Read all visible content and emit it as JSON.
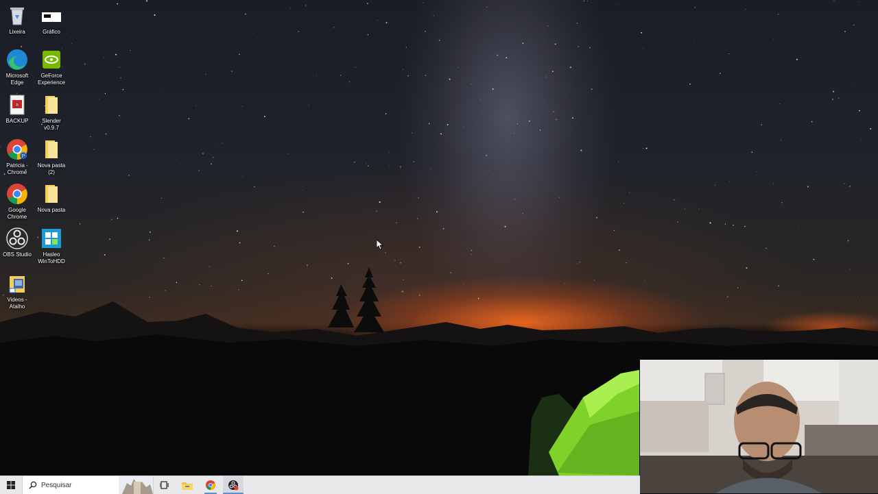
{
  "desktop": {
    "icons": [
      {
        "label": "Lixeira",
        "icon": "recycle-bin-icon"
      },
      {
        "label": "Gráfico",
        "icon": "chart-shortcut-icon"
      },
      {
        "label": "Microsoft Edge",
        "icon": "edge-icon"
      },
      {
        "label": "GeForce Experience",
        "icon": "geforce-icon"
      },
      {
        "label": "BACKUP",
        "icon": "backup-icon"
      },
      {
        "label": "Slender v0.9.7",
        "icon": "folder-icon"
      },
      {
        "label": "Patricia - Chrome",
        "icon": "chrome-profile-icon"
      },
      {
        "label": "Nova pasta (2)",
        "icon": "folder-icon"
      },
      {
        "label": "Google Chrome",
        "icon": "chrome-icon"
      },
      {
        "label": "Nova pasta",
        "icon": "folder-icon"
      },
      {
        "label": "OBS Studio",
        "icon": "obs-icon"
      },
      {
        "label": "Hasleo WinToHDD",
        "icon": "wintohdd-icon"
      },
      {
        "label": "Videos - Atalho",
        "icon": "video-folder-icon"
      }
    ]
  },
  "taskbar": {
    "search_placeholder": "Pesquisar",
    "items": [
      "start-icon",
      "search-icon",
      "task-view-icon",
      "file-explorer-icon",
      "chrome-icon",
      "obs-recording-icon"
    ]
  },
  "colors": {
    "taskbar_bg": "#e9e9ec",
    "accent": "#5a8fd6",
    "horizon_glow": "#ff6e1e",
    "tent_green": "#7fd22a"
  }
}
